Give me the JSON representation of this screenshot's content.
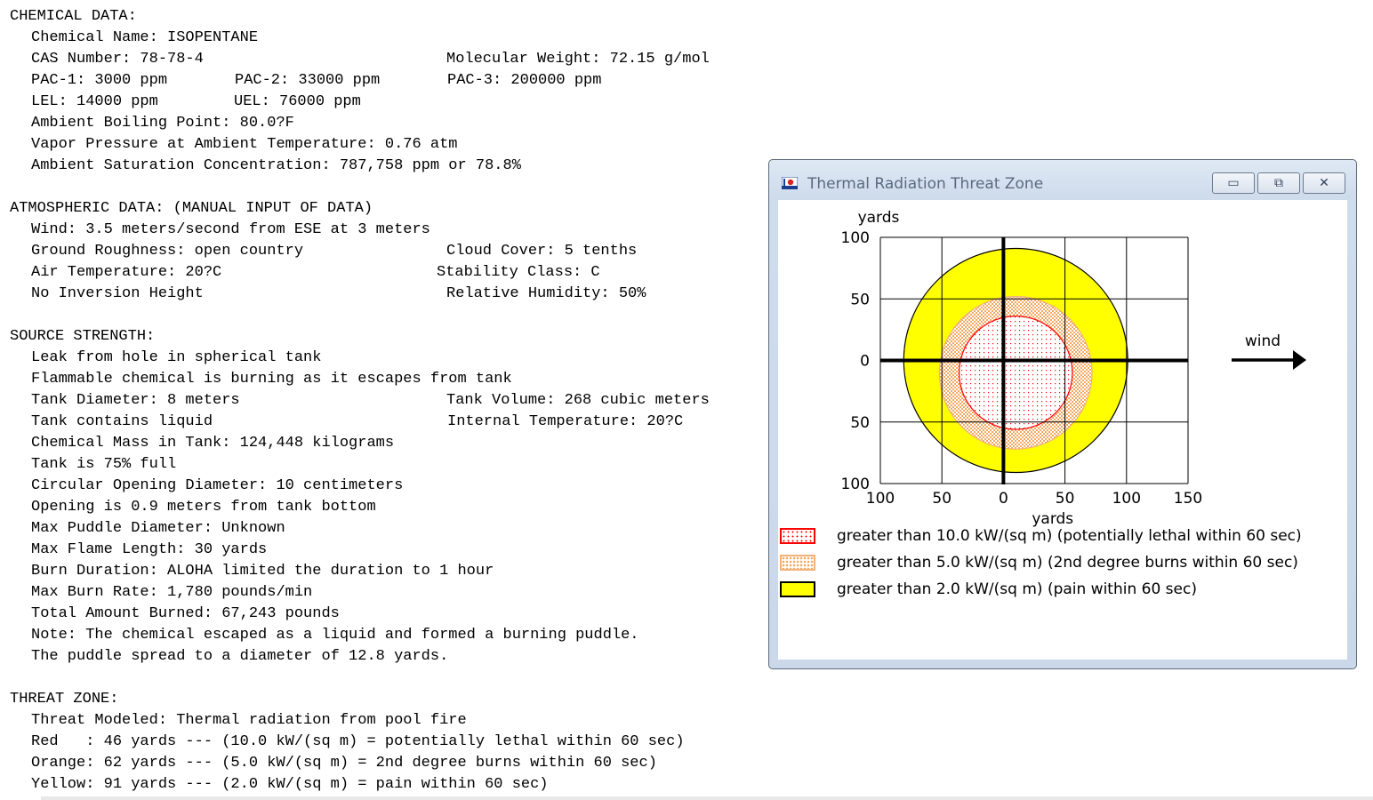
{
  "report": {
    "chemical": {
      "header": "CHEMICAL DATA:",
      "name": "Chemical Name: ISOPENTANE",
      "cas": "CAS Number: 78-78-4",
      "mw": "Molecular Weight: 72.15 g/mol",
      "pac1": "PAC-1: 3000 ppm",
      "pac2": "PAC-2: 33000 ppm",
      "pac3": "PAC-3: 200000 ppm",
      "lel": "LEL: 14000 ppm",
      "uel": "UEL: 76000 ppm",
      "boiling": "Ambient Boiling Point: 80.0?F",
      "vapor": "Vapor Pressure at Ambient Temperature: 0.76 atm",
      "saturation": "Ambient Saturation Concentration: 787,758 ppm or 78.8%"
    },
    "atmospheric": {
      "header": "ATMOSPHERIC DATA: (MANUAL INPUT OF DATA)",
      "wind": "Wind: 3.5 meters/second from ESE at 3 meters",
      "roughness": "Ground Roughness: open country",
      "cloud": "Cloud Cover: 5 tenths",
      "air_temp": "Air Temperature: 20?C",
      "stability": "Stability Class: C",
      "inversion": "No Inversion Height",
      "humidity": "Relative Humidity: 50%"
    },
    "source": {
      "header": "SOURCE STRENGTH:",
      "leak": "Leak from hole in spherical tank",
      "flammable": "Flammable chemical is burning as it escapes from tank",
      "diameter": "Tank Diameter: 8 meters",
      "volume": "Tank Volume: 268 cubic meters",
      "contains": "Tank contains liquid",
      "internal_temp": "Internal Temperature: 20?C",
      "mass": "Chemical Mass in Tank: 124,448 kilograms",
      "full": "Tank is 75% full",
      "opening_diameter": "Circular Opening Diameter: 10 centimeters",
      "opening_height": "Opening is 0.9 meters from tank bottom",
      "puddle_diameter": "Max Puddle Diameter: Unknown",
      "flame_length": "Max Flame Length: 30 yards",
      "burn_duration": "Burn Duration: ALOHA limited the duration to 1 hour",
      "burn_rate": "Max Burn Rate: 1,780 pounds/min",
      "total_burned": "Total Amount Burned: 67,243 pounds",
      "note1": "Note: The chemical escaped as a liquid and formed a burning puddle.",
      "note2": "The puddle spread to a diameter of 12.8 yards."
    },
    "threat": {
      "header": "THREAT ZONE:",
      "modeled": "Threat Modeled: Thermal radiation from pool fire",
      "red": "Red   : 46 yards --- (10.0 kW/(sq m) = potentially lethal within 60 sec)",
      "orange": "Orange: 62 yards --- (5.0 kW/(sq m) = 2nd degree burns within 60 sec)",
      "yellow": "Yellow: 91 yards --- (2.0 kW/(sq m) = pain within 60 sec)"
    }
  },
  "window": {
    "title": "Thermal Radiation Threat Zone",
    "minimize_glyph": "▭",
    "maximize_glyph": "⧉",
    "close_glyph": "✕"
  },
  "chart_data": {
    "type": "threat-zone-map",
    "xlabel": "yards",
    "ylabel": "yards",
    "xlim": [
      -100,
      150
    ],
    "ylim": [
      -100,
      100
    ],
    "x_ticks": [
      -100,
      -50,
      0,
      50,
      100,
      150
    ],
    "x_tick_labels": [
      "100",
      "50",
      "0",
      "50",
      "100",
      "150"
    ],
    "y_ticks": [
      100,
      50,
      0,
      -50,
      -100
    ],
    "y_tick_labels": [
      "100",
      "50",
      "0",
      "50",
      "100"
    ],
    "grid": true,
    "wind_label": "wind",
    "zones": [
      {
        "name": "yellow",
        "radius": 91,
        "center_x": 10,
        "center_y": 0,
        "color": "#ffff00"
      },
      {
        "name": "orange",
        "radius": 62,
        "center_x": 10,
        "center_y": -10,
        "color": "#f6c98a"
      },
      {
        "name": "red",
        "radius": 46,
        "center_x": 10,
        "center_y": -10,
        "color": "#ff0000"
      }
    ],
    "legend": [
      {
        "label": "greater than 10.0 kW/(sq m) (potentially lethal within 60 sec)",
        "color": "#ff0000"
      },
      {
        "label": "greater than 5.0 kW/(sq m) (2nd degree burns within 60 sec)",
        "color": "#f6c98a"
      },
      {
        "label": "greater than 2.0 kW/(sq m) (pain within 60 sec)",
        "color": "#ffff00"
      }
    ]
  }
}
